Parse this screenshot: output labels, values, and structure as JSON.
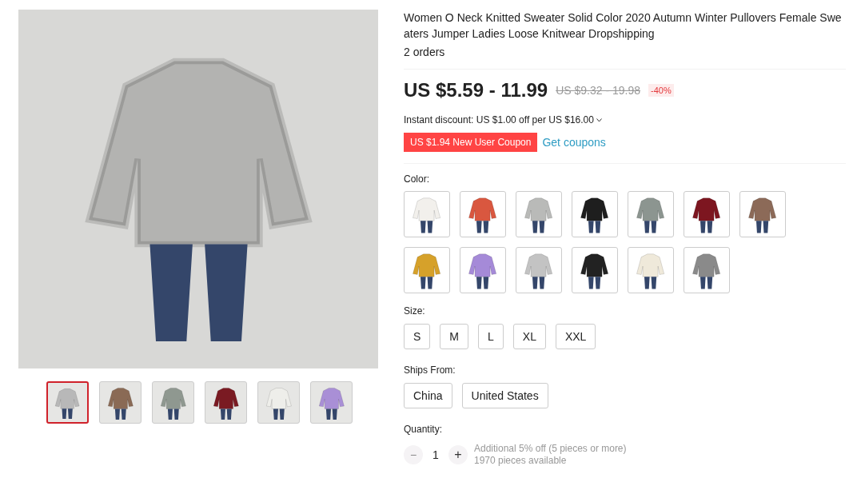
{
  "gallery": {
    "thumbnails": [
      {
        "color": "#b8b8b8",
        "selected": true
      },
      {
        "color": "#8a6a55",
        "selected": false
      },
      {
        "color": "#8f9890",
        "selected": false
      },
      {
        "color": "#7a1a22",
        "selected": false
      },
      {
        "color": "#eeeeea",
        "selected": false
      },
      {
        "color": "#a98fd6",
        "selected": false
      }
    ]
  },
  "title": "Women O Neck Knitted Sweater Solid Color 2020 Autumn Winter Pullovers Female Sweaters Jumper Ladies Loose Knitwear Dropshipping",
  "orders": "2 orders",
  "price": {
    "current": "US $5.59 - 11.99",
    "original": "US $9.32 - 19.98",
    "discount": "-40%"
  },
  "instant_discount": "Instant discount: US $1.00 off per US $16.00",
  "coupon": {
    "label": "US $1.94 New User Coupon",
    "link": "Get coupons"
  },
  "color": {
    "label": "Color:",
    "options": [
      {
        "color": "#f2f0ec",
        "selected": false
      },
      {
        "color": "#d9573f",
        "selected": false
      },
      {
        "color": "#b9bab8",
        "selected": false
      },
      {
        "color": "#1e1e1e",
        "selected": false
      },
      {
        "color": "#8c9590",
        "selected": false
      },
      {
        "color": "#7d1620",
        "selected": false
      },
      {
        "color": "#8c6a58",
        "selected": false
      },
      {
        "color": "#d6a12a",
        "selected": false
      },
      {
        "color": "#a58ad8",
        "selected": false
      },
      {
        "color": "#c3c3c3",
        "selected": false
      },
      {
        "color": "#222222",
        "selected": false
      },
      {
        "color": "#efe9da",
        "selected": false
      },
      {
        "color": "#8a8a8a",
        "selected": false
      }
    ]
  },
  "size": {
    "label": "Size:",
    "options": [
      {
        "label": "S",
        "selected": false
      },
      {
        "label": "M",
        "selected": false
      },
      {
        "label": "L",
        "selected": false
      },
      {
        "label": "XL",
        "selected": false
      },
      {
        "label": "XXL",
        "selected": false
      }
    ]
  },
  "ships_from": {
    "label": "Ships From:",
    "options": [
      {
        "label": "China",
        "selected": false
      },
      {
        "label": "United States",
        "selected": false
      }
    ]
  },
  "quantity": {
    "label": "Quantity:",
    "minus": "−",
    "value": "1",
    "plus": "+",
    "minus_disabled": true,
    "note": "Additional 5% off (5 pieces or more)",
    "available": "1970 pieces available"
  }
}
